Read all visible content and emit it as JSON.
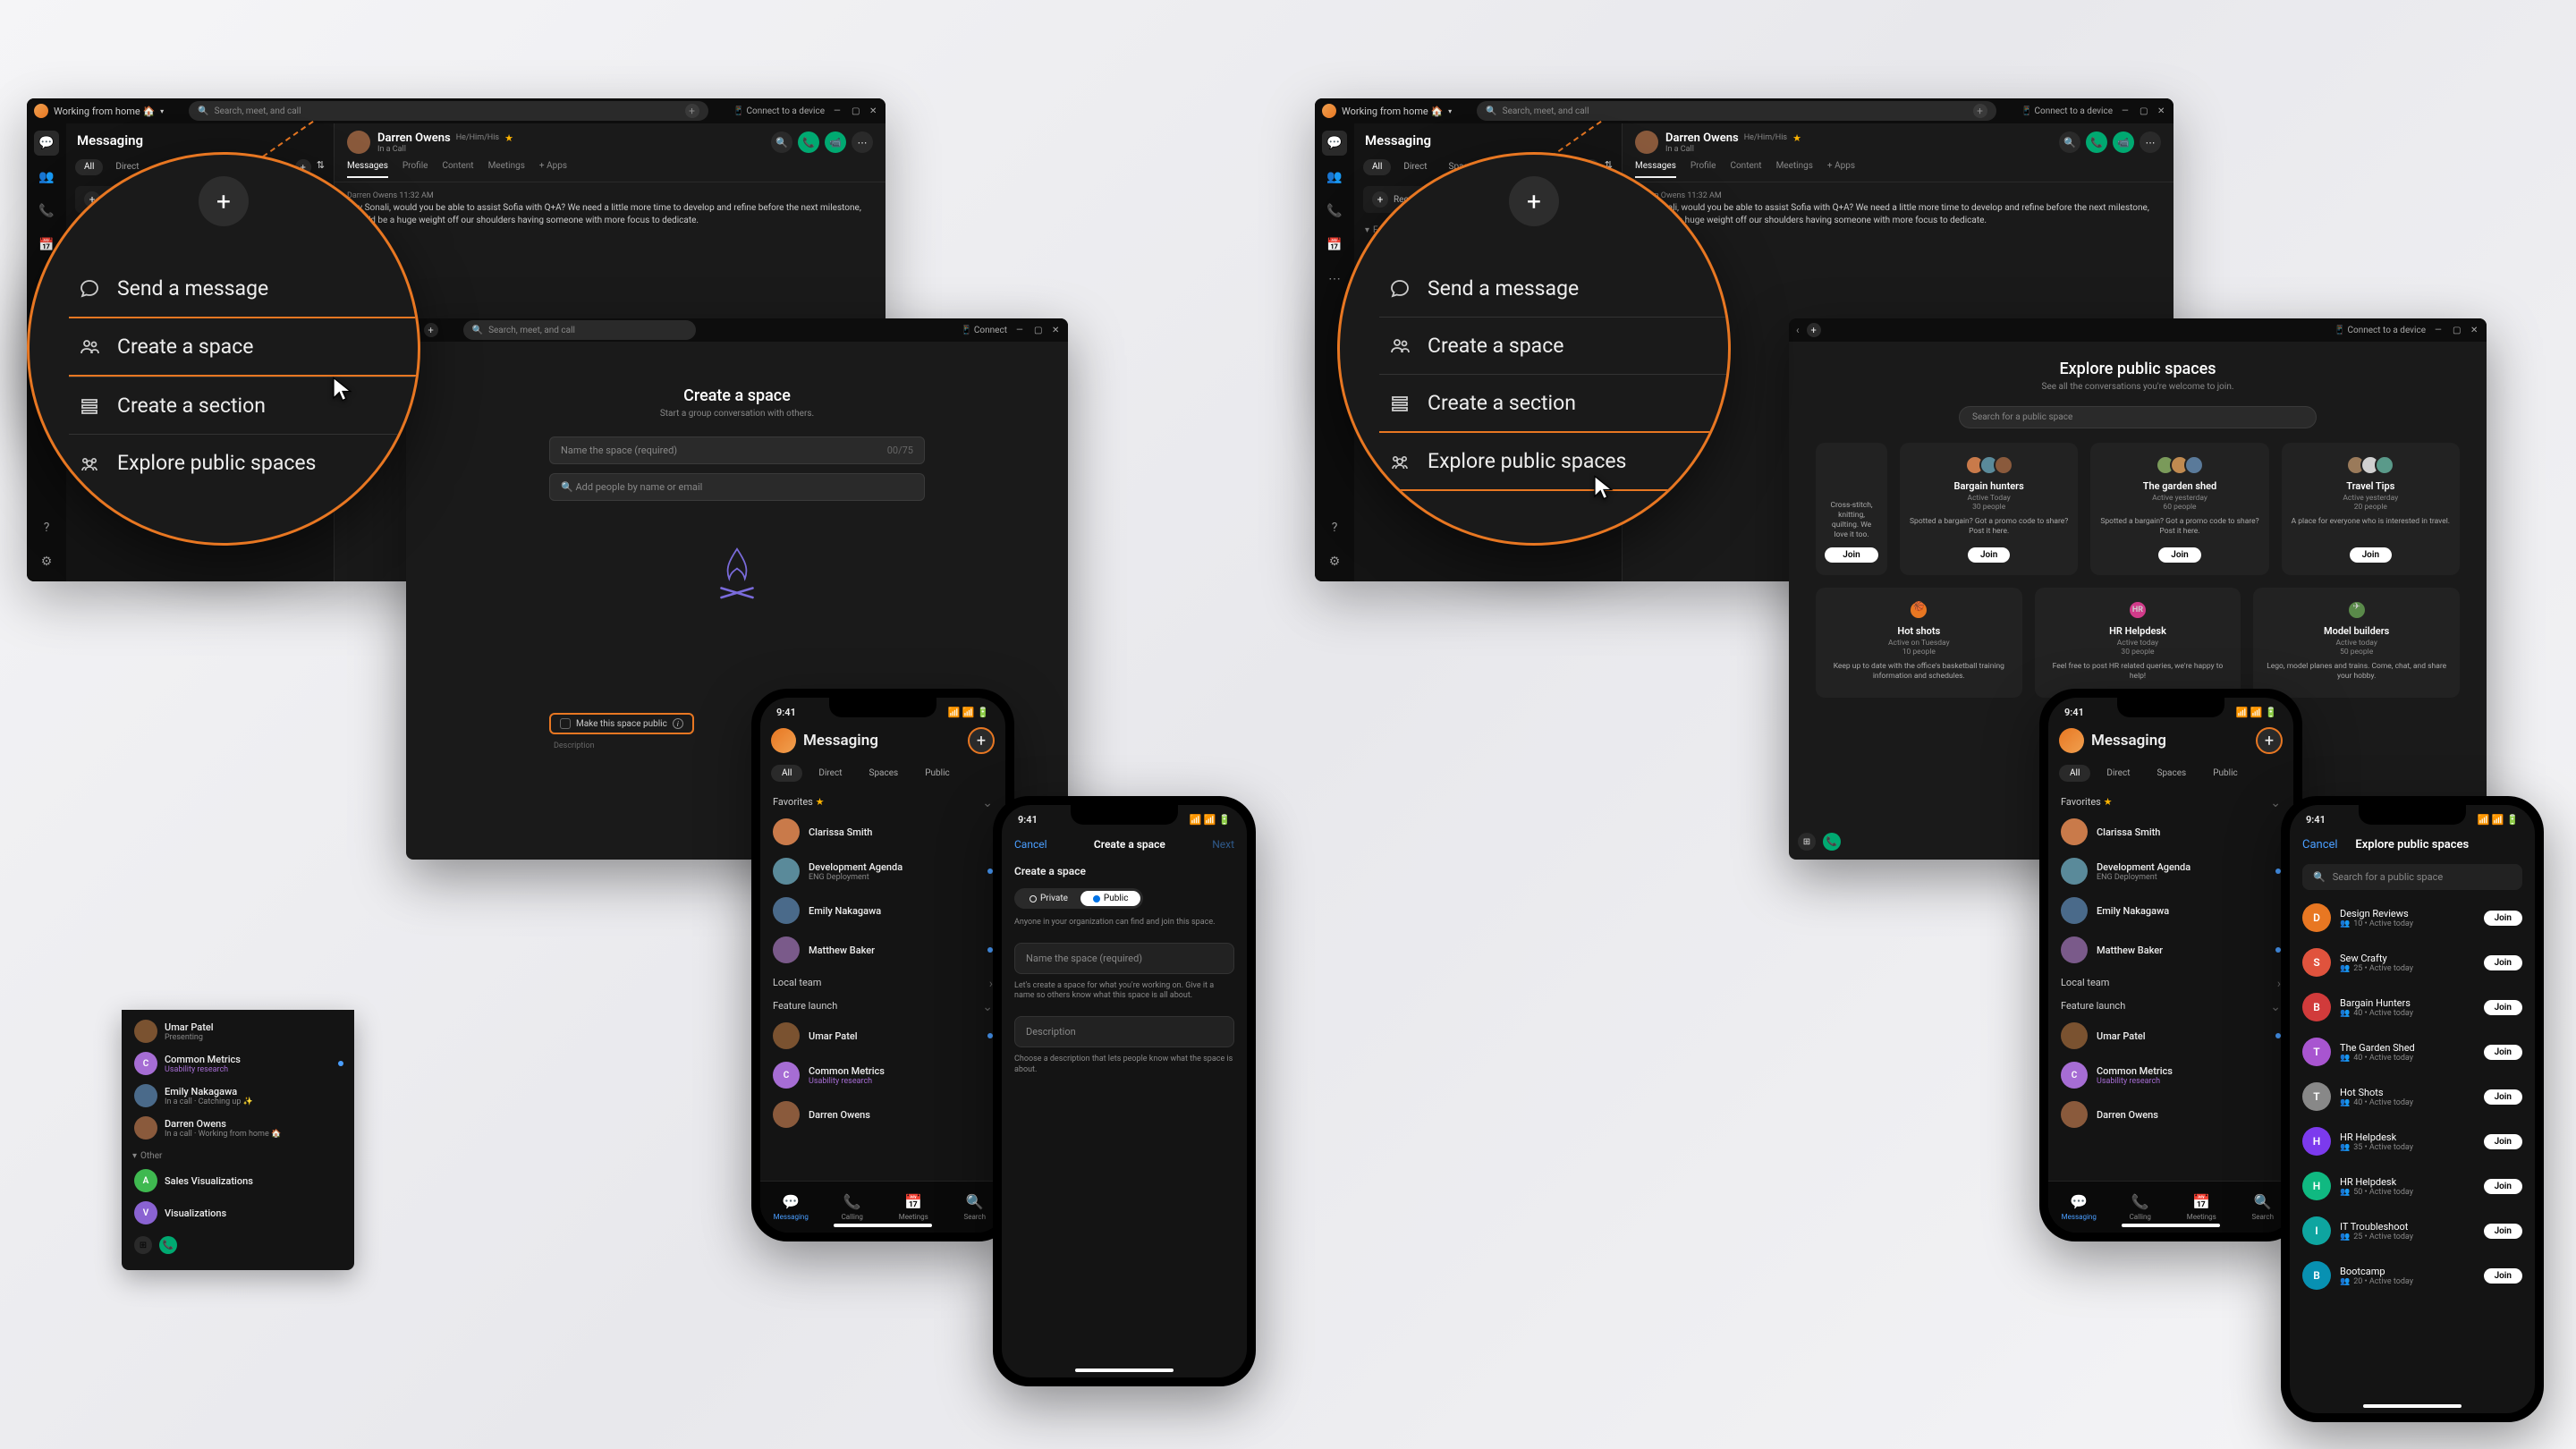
{
  "status": "Working from home 🏠",
  "search_placeholder": "Search, meet, and call",
  "connect_device": "Connect to a device",
  "connect_short": "Connect",
  "messaging_title": "Messaging",
  "sidebar_tabs": [
    "All",
    "Direct",
    "Spaces",
    "Public"
  ],
  "recommended": "Recommended Messages",
  "favorites_label": "Favorites",
  "other_label": "Other",
  "contact": {
    "name": "Darren Owens",
    "pronouns": "He/Him/His",
    "status": "In a Call"
  },
  "conv_tabs": [
    "Messages",
    "Profile",
    "Content",
    "Meetings",
    "+ Apps"
  ],
  "msg": {
    "author": "Darren Owens",
    "time": "11:32 AM",
    "body": "Hey Sonali, would you be able to assist Sofia with Q+A? We need a little more time to develop and refine before the next milestone, and it'd be a huge weight off our shoulders having someone with more focus to dedicate."
  },
  "plus_menu": [
    "Send a message",
    "Create a space",
    "Create a section",
    "Explore public spaces"
  ],
  "highlight_left": "Create a space",
  "highlight_right": "Explore public spaces",
  "create_space": {
    "title": "Create a space",
    "subtitle": "Start a group conversation with others.",
    "name_ph": "Name the space (required)",
    "counter": "00/75",
    "people_ph": "Add people by name or email",
    "make_public": "Make this space public",
    "desc_label": "Description"
  },
  "explore": {
    "title": "Explore public spaces",
    "subtitle": "See all the conversations you're welcome to join.",
    "search_ph": "Search for a public space",
    "cards": [
      {
        "name": "Bargain hunters",
        "activity": "Active Today",
        "people": "30 people",
        "desc": "Spotted a bargain? Got a promo code to share? Post it here."
      },
      {
        "name": "The garden shed",
        "activity": "Active yesterday",
        "people": "60 people",
        "desc": "Spotted a bargain? Got a promo code to share? Post it here."
      },
      {
        "name": "Travel Tips",
        "activity": "Active yesterday",
        "people": "20 people",
        "desc": "A place for everyone who is interested in travel."
      },
      {
        "name": "Hot shots",
        "activity": "Active on Tuesday",
        "people": "10 people",
        "desc": "Keep up to date with the office's basketball training information and schedules."
      },
      {
        "name": "HR Helpdesk",
        "activity": "Active today",
        "people": "30 people",
        "desc": "Feel free to post HR related queries, we're happy to help!"
      },
      {
        "name": "Model builders",
        "activity": "Active today",
        "people": "50 people",
        "desc": "Lego, model planes and trains. Come, chat, and share your hobby."
      }
    ],
    "card_partial": {
      "desc": "Cross-stitch, knitting, quilting. We love it too."
    },
    "join": "Join"
  },
  "sidebar_items_lower": [
    {
      "name": "Umar Patel",
      "sub": "Presenting"
    },
    {
      "name": "Common Metrics",
      "sub": "Usability research",
      "accent": true,
      "avatar": "C",
      "color": "#a66dd4"
    },
    {
      "name": "Emily Nakagawa",
      "sub": "In a call  ·  Catching up ✨"
    },
    {
      "name": "Darren Owens",
      "sub": "In a call  ·  Working from home 🏠"
    }
  ],
  "sidebar_visual": [
    {
      "name": "Sales Visualizations",
      "avatar": "A",
      "color": "#3fb950"
    },
    {
      "name": "Visualizations",
      "avatar": "V",
      "color": "#8a63d2"
    }
  ],
  "mobile": {
    "time": "9:41",
    "title": "Messaging",
    "tabs": [
      "All",
      "Direct",
      "Spaces",
      "Public"
    ],
    "favorites": "Favorites",
    "local_team": "Local team",
    "feature_launch": "Feature launch",
    "items": [
      {
        "name": "Clarissa Smith"
      },
      {
        "name": "Development Agenda",
        "sub": "ENG Deployment"
      },
      {
        "name": "Emily Nakagawa"
      },
      {
        "name": "Matthew Baker"
      }
    ],
    "items2": [
      {
        "name": "Umar Patel"
      },
      {
        "name": "Common Metrics",
        "sub": "Usability research",
        "avatar": "C",
        "color": "#a66dd4"
      },
      {
        "name": "Darren Owens"
      }
    ],
    "nav": [
      "Messaging",
      "Calling",
      "Meetings",
      "Search"
    ]
  },
  "mobile_form": {
    "cancel": "Cancel",
    "title": "Create a space",
    "next": "Next",
    "heading": "Create a space",
    "private": "Private",
    "public": "Public",
    "help_public": "Anyone in your organization can find and join this space.",
    "name_ph": "Name the space (required)",
    "help_name": "Let's create a space for what you're working on. Give it a name so others know what this space is all about.",
    "desc_ph": "Description",
    "help_desc": "Choose a description that lets people know what the space is about."
  },
  "mobile_explore": {
    "cancel": "Cancel",
    "title": "Explore public spaces",
    "search_ph": "Search for a public space",
    "items": [
      {
        "name": "Design Reviews",
        "meta": "10  •  Active today",
        "color": "#e87722",
        "initial": "D"
      },
      {
        "name": "Sew Crafty",
        "meta": "25  •  Active today",
        "color": "#e0533d",
        "initial": "S"
      },
      {
        "name": "Bargain Hunters",
        "meta": "40  •  Active today",
        "color": "#d13b3b",
        "initial": "B"
      },
      {
        "name": "The Garden Shed",
        "meta": "40  •  Active today",
        "color": "#a855d0",
        "initial": "T"
      },
      {
        "name": "Hot Shots",
        "meta": "40  •  Active today",
        "color": "#888",
        "initial": "T"
      },
      {
        "name": "HR Helpdesk",
        "meta": "35  •  Active today",
        "color": "#7c3aed",
        "initial": "H"
      },
      {
        "name": "HR Helpdesk",
        "meta": "50  •  Active today",
        "color": "#10b981",
        "initial": "H"
      },
      {
        "name": "IT Troubleshoot",
        "meta": "25  •  Active today",
        "color": "#0ea5a0",
        "initial": "I"
      },
      {
        "name": "Bootcamp",
        "meta": "20  •  Active today",
        "color": "#0891b2",
        "initial": "B"
      }
    ],
    "join": "Join"
  }
}
